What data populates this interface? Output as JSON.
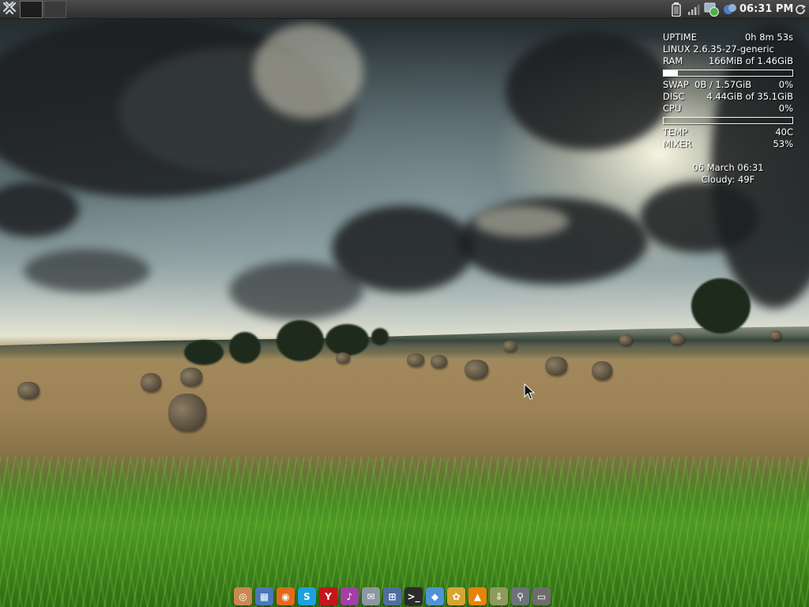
{
  "top_panel": {
    "clock": "06:31 PM",
    "workspaces": [
      "workspace-1",
      "workspace-2"
    ]
  },
  "conky": {
    "uptime_label": "UPTIME",
    "uptime_value": "0h 8m 53s",
    "kernel": "LINUX 2.6.35-27-generic",
    "ram_label": "RAM",
    "ram_value": "166MiB of 1.46GiB",
    "ram_fraction": 0.11,
    "swap_label": "SWAP",
    "swap_value": "0B  / 1.57GiB",
    "swap_percent": "0%",
    "disc_label": "DISC",
    "disc_value": "4.44GiB of 35.1GiB",
    "cpu_label": "CPU",
    "cpu_percent": "0%",
    "cpu_fraction": 0.0,
    "temp_label": "TEMP",
    "temp_value": "40C",
    "mixer_label": "MIXER",
    "mixer_value": "53%",
    "date": "06 March 06:31",
    "weather": "Cloudy: 49F"
  },
  "dock": {
    "icons": [
      {
        "name": "ubuntu-software-icon",
        "color": "#c9884f",
        "glyph": "◎"
      },
      {
        "name": "image-viewer-icon",
        "color": "#4a78b6",
        "glyph": "▦"
      },
      {
        "name": "firefox-icon",
        "color": "#e26a1c",
        "glyph": "◉"
      },
      {
        "name": "skype-icon",
        "color": "#1aa3e0",
        "glyph": "S"
      },
      {
        "name": "yahoo-icon",
        "color": "#c4161c",
        "glyph": "Y"
      },
      {
        "name": "music-player-icon",
        "color": "#a240a6",
        "glyph": "♪"
      },
      {
        "name": "mail-icon",
        "color": "#8d97a3",
        "glyph": "✉"
      },
      {
        "name": "network-icon",
        "color": "#4e6f9d",
        "glyph": "⊞"
      },
      {
        "name": "terminal-icon",
        "color": "#2b2b2b",
        "glyph": ">_"
      },
      {
        "name": "dropbox-icon",
        "color": "#4e93d6",
        "glyph": "◆"
      },
      {
        "name": "photo-editor-icon",
        "color": "#d7a532",
        "glyph": "✿"
      },
      {
        "name": "vlc-icon",
        "color": "#e8830c",
        "glyph": "▲"
      },
      {
        "name": "download-icon",
        "color": "#8f9a5a",
        "glyph": "⇩"
      },
      {
        "name": "search-icon",
        "color": "#6c737a",
        "glyph": "⚲"
      },
      {
        "name": "folder-icon",
        "color": "#6d6d6d",
        "glyph": "▭"
      }
    ]
  }
}
